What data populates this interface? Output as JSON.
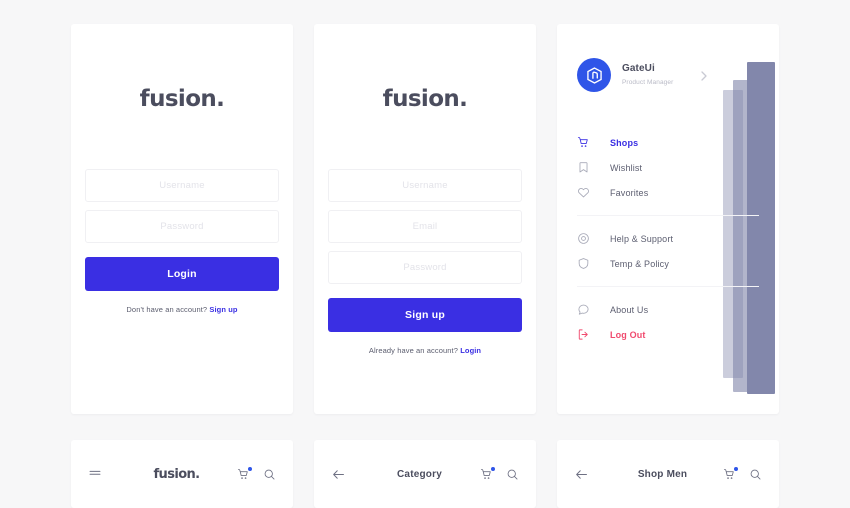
{
  "theme": {
    "background": "#f7f7f8",
    "card": "#ffffff",
    "primary": "#3a2fe3",
    "avatar_blue": "#2f55e8",
    "danger": "#f04a6e",
    "text": "#4b4d5e",
    "muted": "#b9bac6",
    "placeholder": "#e3e3e9",
    "panel": "#8287ab"
  },
  "brand": {
    "name": "fusion",
    "dot": "."
  },
  "login_screen": {
    "logo": "fusion.",
    "fields": [
      {
        "name": "username",
        "placeholder": "Username",
        "value": ""
      },
      {
        "name": "password",
        "placeholder": "Password",
        "value": ""
      }
    ],
    "submit_label": "Login",
    "footer_text": "Don't have an account?",
    "footer_link": "Sign up"
  },
  "signup_screen": {
    "logo": "fusion.",
    "fields": [
      {
        "name": "username",
        "placeholder": "Username",
        "value": ""
      },
      {
        "name": "email",
        "placeholder": "Email",
        "value": ""
      },
      {
        "name": "password",
        "placeholder": "Password",
        "value": ""
      }
    ],
    "submit_label": "Sign up",
    "footer_text": "Already have an account?",
    "footer_link": "Login"
  },
  "menu_screen": {
    "profile": {
      "name": "GateUi",
      "role": "Product Manager",
      "avatar_icon": "hexagon-logo-icon",
      "chevron_icon": "chevron-right-icon"
    },
    "groups": [
      {
        "items": [
          {
            "label": "Shops",
            "icon": "cart-icon",
            "state": "active"
          },
          {
            "label": "Wishlist",
            "icon": "bookmark-icon",
            "state": "default"
          },
          {
            "label": "Favorites",
            "icon": "heart-icon",
            "state": "default"
          }
        ]
      },
      {
        "items": [
          {
            "label": "Help & Support",
            "icon": "help-circle-icon",
            "state": "default"
          },
          {
            "label": "Temp & Policy",
            "icon": "shield-icon",
            "state": "default"
          }
        ]
      },
      {
        "items": [
          {
            "label": "About Us",
            "icon": "chat-bubble-icon",
            "state": "default"
          },
          {
            "label": "Log Out",
            "icon": "logout-icon",
            "state": "danger"
          }
        ]
      }
    ]
  },
  "navbars": [
    {
      "left_icon": "hamburger-menu-icon",
      "title": "fusion.",
      "title_type": "logo",
      "cart_icon": "cart-icon",
      "search_icon": "search-icon",
      "cart_badge": true
    },
    {
      "left_icon": "arrow-left-icon",
      "title": "Category",
      "title_type": "text",
      "cart_icon": "cart-icon",
      "search_icon": "search-icon",
      "cart_badge": true
    },
    {
      "left_icon": "arrow-left-icon",
      "title": "Shop Men",
      "title_type": "text",
      "cart_icon": "cart-icon",
      "search_icon": "search-icon",
      "cart_badge": true
    }
  ]
}
